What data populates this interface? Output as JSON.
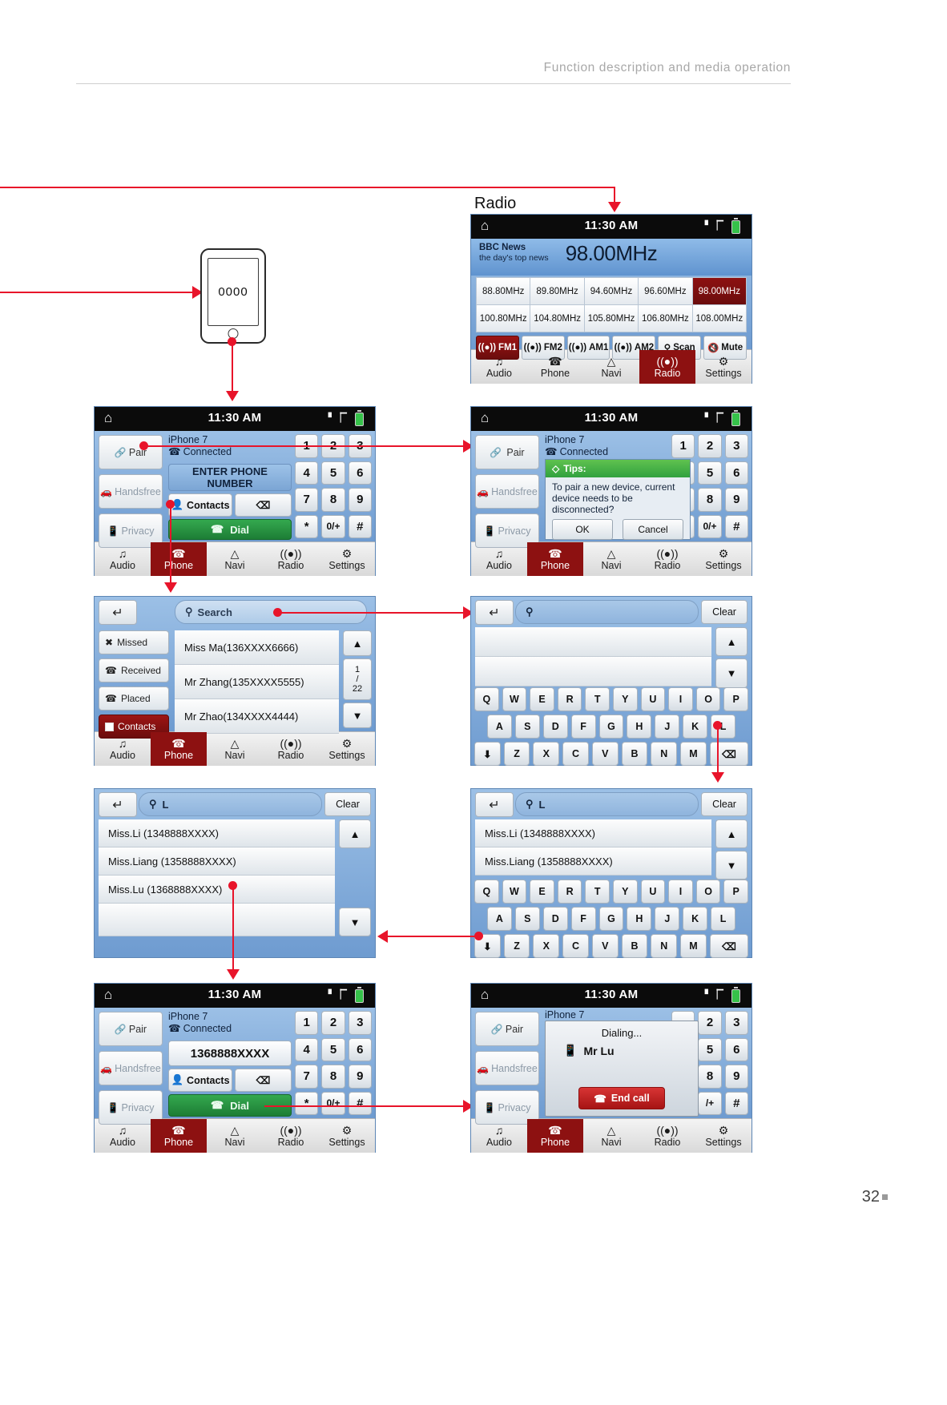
{
  "page": {
    "header_title": "Function description and media operation",
    "page_number": "32"
  },
  "labels": {
    "radio_section": "Radio"
  },
  "handset": {
    "pin": "0000"
  },
  "status_bar": {
    "time": "11:30 AM",
    "home_icon": "home-icon",
    "signal_icon": "signal-icon",
    "battery_icon": "battery-icon"
  },
  "nav": {
    "items": [
      {
        "label": "Audio",
        "icon": "music-note-icon",
        "active": false
      },
      {
        "label": "Phone",
        "icon": "phone-handset-icon",
        "active": false
      },
      {
        "label": "Navi",
        "icon": "navigation-arrow-icon",
        "active": false
      },
      {
        "label": "Radio",
        "icon": "radio-waves-icon",
        "active": false
      },
      {
        "label": "Settings",
        "icon": "gear-icon",
        "active": false
      }
    ]
  },
  "radio_screen": {
    "station_name": "BBC News",
    "station_tagline": "the day's top news",
    "frequency": "98.00MHz",
    "presets": [
      "88.80MHz",
      "89.80MHz",
      "94.60MHz",
      "96.60MHz",
      "98.00MHz",
      "100.80MHz",
      "104.80MHz",
      "105.80MHz",
      "106.80MHz",
      "108.00MHz"
    ],
    "active_preset_index": 4,
    "bands": [
      {
        "label": "FM1",
        "active": true
      },
      {
        "label": "FM2",
        "active": false
      },
      {
        "label": "AM1",
        "active": false
      },
      {
        "label": "AM2",
        "active": false
      }
    ],
    "scan_label": "Scan",
    "mute_label": "Mute",
    "active_nav": "Radio"
  },
  "dialer_screen": {
    "device_name": "iPhone 7",
    "connection_status": "Connected",
    "entry_placeholder": "ENTER PHONE NUMBER",
    "rail": [
      {
        "label": "Pair",
        "icon": "link-icon",
        "dim": false
      },
      {
        "label": "Handsfree",
        "icon": "car-icon",
        "dim": true
      },
      {
        "label": "Privacy",
        "icon": "mobile-icon",
        "dim": true
      }
    ],
    "contacts_label": "Contacts",
    "backspace_icon": "backspace-icon",
    "dial_label": "Dial",
    "keys": [
      "1",
      "2",
      "3",
      "4",
      "5",
      "6",
      "7",
      "8",
      "9",
      "*",
      "0/+",
      "#"
    ],
    "active_nav": "Phone"
  },
  "tips_screen": {
    "device_name": "iPhone 7",
    "connection_status": "Connected",
    "tips_title": "Tips:",
    "tips_body": "To pair a new device, current device needs to be disconnected?",
    "ok_label": "OK",
    "cancel_label": "Cancel",
    "visible_keys": [
      "1",
      "2",
      "3",
      "5",
      "6",
      "8",
      "9",
      "0/+",
      "#"
    ],
    "active_nav": "Phone"
  },
  "contacts_screen": {
    "back_icon": "back-arrow-icon",
    "search_placeholder": "Search",
    "search_icon": "search-icon",
    "categories": [
      {
        "label": "Missed",
        "icon": "missed-call-icon",
        "active": false
      },
      {
        "label": "Received",
        "icon": "received-call-icon",
        "active": false
      },
      {
        "label": "Placed",
        "icon": "placed-call-icon",
        "active": false
      },
      {
        "label": "Contacts",
        "icon": "contacts-icon",
        "active": true
      }
    ],
    "entries": [
      "Miss Ma(136XXXX6666)",
      "Mr Zhang(135XXXX5555)",
      "Mr Zhao(134XXXX4444)"
    ],
    "page_indicator": {
      "current": "1",
      "separator": "/",
      "total": "22"
    },
    "up_icon": "arrow-up-icon",
    "down_icon": "arrow-down-icon",
    "active_nav": "Phone"
  },
  "keyboard_screen": {
    "back_icon": "back-arrow-icon",
    "search_icon": "search-icon",
    "search_value": "",
    "clear_label": "Clear",
    "rows": [
      [
        "Q",
        "W",
        "E",
        "R",
        "T",
        "Y",
        "U",
        "I",
        "O",
        "P"
      ],
      [
        "A",
        "S",
        "D",
        "F",
        "G",
        "H",
        "J",
        "K",
        "L"
      ],
      [
        "Z",
        "X",
        "C",
        "V",
        "B",
        "N",
        "M"
      ]
    ],
    "shift_icon": "arrow-down-icon",
    "backspace_icon": "backspace-icon",
    "up_icon": "arrow-up-icon",
    "down_icon": "arrow-down-icon"
  },
  "results_left_screen": {
    "back_icon": "back-arrow-icon",
    "search_icon": "search-icon",
    "search_value": "L",
    "clear_label": "Clear",
    "entries": [
      "Miss.Li (1348888XXXX)",
      "Miss.Liang  (1358888XXXX)",
      "Miss.Lu  (1368888XXXX)"
    ],
    "up_icon": "arrow-up-icon",
    "down_icon": "arrow-down-icon"
  },
  "results_right_screen": {
    "back_icon": "back-arrow-icon",
    "search_icon": "search-icon",
    "search_value": "L",
    "clear_label": "Clear",
    "entries": [
      "Miss.Li (1348888XXXX)",
      "Miss.Liang  (1358888XXXX)"
    ],
    "rows": [
      [
        "Q",
        "W",
        "E",
        "R",
        "T",
        "Y",
        "U",
        "I",
        "O",
        "P"
      ],
      [
        "A",
        "S",
        "D",
        "F",
        "G",
        "H",
        "J",
        "K",
        "L"
      ],
      [
        "Z",
        "X",
        "C",
        "V",
        "B",
        "N",
        "M"
      ]
    ],
    "shift_icon": "arrow-down-icon",
    "backspace_icon": "backspace-icon",
    "up_icon": "arrow-up-icon",
    "down_icon": "arrow-down-icon"
  },
  "number_entered_screen": {
    "device_name": "iPhone 7",
    "connection_status": "Connected",
    "number": "1368888XXXX",
    "contacts_label": "Contacts",
    "dial_label": "Dial",
    "keys": [
      "1",
      "2",
      "3",
      "4",
      "5",
      "6",
      "7",
      "8",
      "9",
      "*",
      "0/+",
      "#"
    ],
    "rail": [
      {
        "label": "Pair",
        "icon": "link-icon",
        "dim": false
      },
      {
        "label": "Handsfree",
        "icon": "car-icon",
        "dim": true
      },
      {
        "label": "Privacy",
        "icon": "mobile-icon",
        "dim": true
      }
    ],
    "active_nav": "Phone"
  },
  "calling_screen": {
    "device_name": "iPhone 7",
    "dialing_label": "Dialing...",
    "contact_name": "Mr Lu",
    "contact_icon": "mobile-icon",
    "end_call_label": "End call",
    "end_call_icon": "end-call-icon",
    "visible_keys": [
      "2",
      "3",
      "5",
      "6",
      "8",
      "9",
      "/+",
      "#"
    ],
    "rail": [
      {
        "label": "Pair",
        "icon": "link-icon",
        "dim": false
      },
      {
        "label": "Handsfree",
        "icon": "car-icon",
        "dim": true
      },
      {
        "label": "Privacy",
        "icon": "mobile-icon",
        "dim": true
      }
    ],
    "active_nav": "Phone"
  },
  "colors": {
    "accent_red": "#e8142a",
    "active_tab": "#8d1111",
    "dial_green": "#2b9444",
    "screen_blue": "#7ba7d8"
  }
}
